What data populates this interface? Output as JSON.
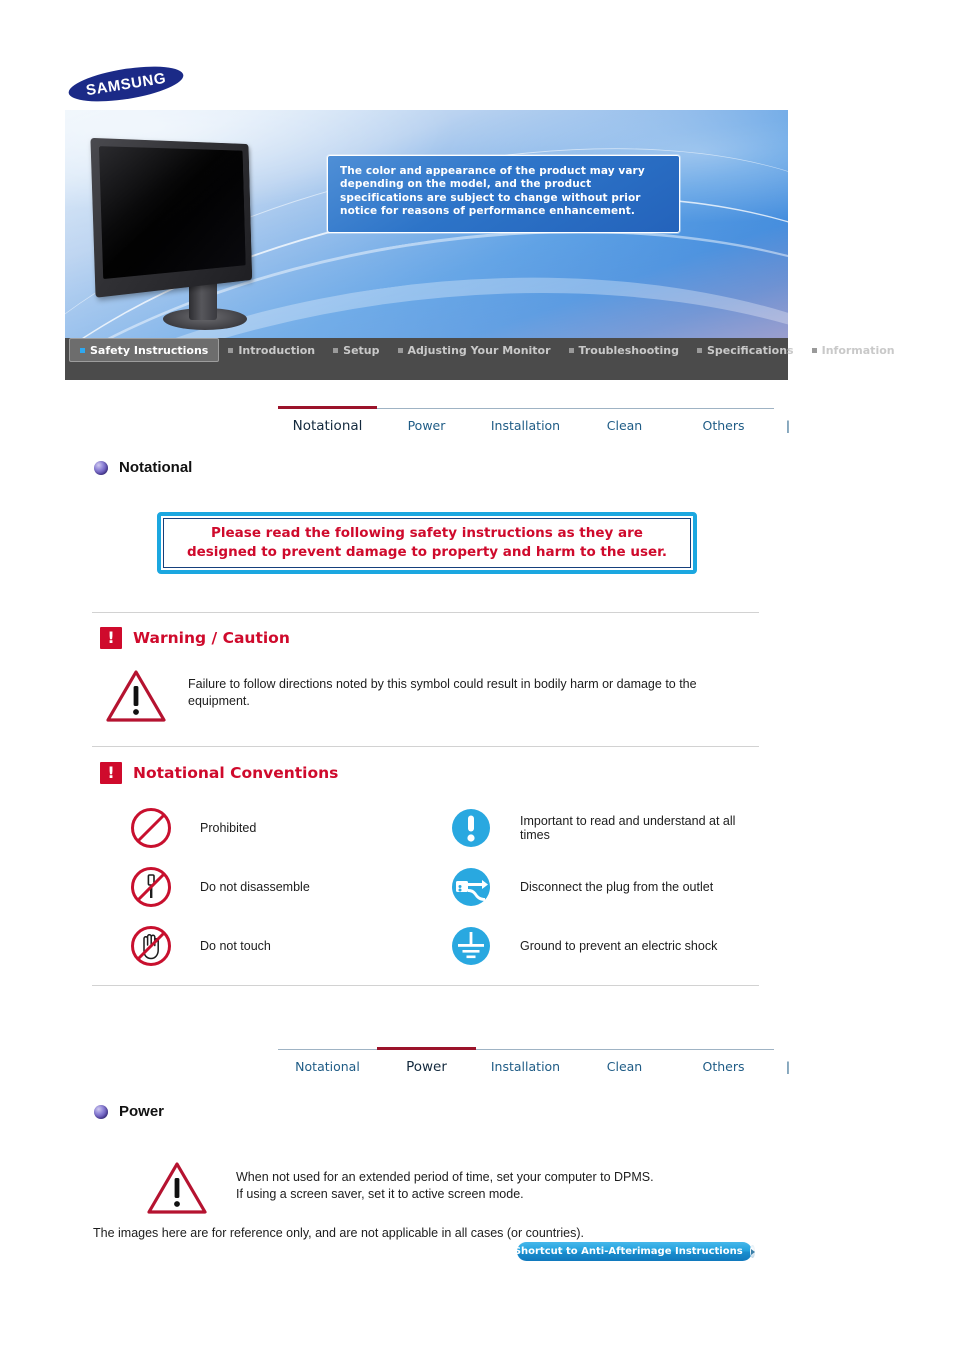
{
  "brand": {
    "logo_text": "SAMSUNG"
  },
  "banner": {
    "notice_text": "The color and appearance of the product may vary depending on the model, and the product specifications are subject to change without prior notice for reasons of performance enhancement.",
    "monitor_icon": "lcd-monitor-illustration"
  },
  "nav": {
    "items": [
      {
        "label": "Safety Instructions",
        "active": true
      },
      {
        "label": "Introduction",
        "active": false
      },
      {
        "label": "Setup",
        "active": false
      },
      {
        "label": "Adjusting Your Monitor",
        "active": false
      },
      {
        "label": "Troubleshooting",
        "active": false
      },
      {
        "label": "Specifications",
        "active": false
      },
      {
        "label": "Information",
        "active": false
      }
    ]
  },
  "tabs_notational": [
    {
      "label": "Notational",
      "active": true
    },
    {
      "label": "Power",
      "active": false
    },
    {
      "label": "Installation",
      "active": false
    },
    {
      "label": "Clean",
      "active": false
    },
    {
      "label": "Others",
      "active": false
    }
  ],
  "tabs_power": [
    {
      "label": "Notational",
      "active": false
    },
    {
      "label": "Power",
      "active": true
    },
    {
      "label": "Installation",
      "active": false
    },
    {
      "label": "Clean",
      "active": false
    },
    {
      "label": "Others",
      "active": false
    }
  ],
  "notational_section": {
    "heading": "Notational",
    "notice_line1": "Please read the following safety instructions as they are",
    "notice_line2": "designed to prevent damage to property and harm to the user.",
    "warning": {
      "heading": "Warning / Caution",
      "excl": "!",
      "body": "Failure to follow directions noted by this symbol could result in bodily harm or damage to the equipment."
    },
    "conventions": {
      "heading": "Notational Conventions",
      "excl": "!",
      "rows": [
        {
          "left_icon": "prohibited-icon",
          "left_label": "Prohibited",
          "right_icon": "important-exclamation-icon",
          "right_label": "Important to read and understand at all times"
        },
        {
          "left_icon": "do-not-disassemble-icon",
          "left_label": "Do not disassemble",
          "right_icon": "disconnect-plug-icon",
          "right_label": "Disconnect the plug from the outlet"
        },
        {
          "left_icon": "do-not-touch-icon",
          "left_label": "Do not touch",
          "right_icon": "ground-earth-icon",
          "right_label": "Ground to prevent an electric shock"
        }
      ]
    }
  },
  "power_section": {
    "heading": "Power",
    "warning_line1": "When not used for an extended period of time, set your computer to DPMS.",
    "warning_line2": "If using a screen saver, set it to active screen mode.",
    "reference_note": "The images here are for reference only, and are not applicable in all cases (or countries).",
    "shortcut_label": "Shortcut to Anti-Afterimage Instructions",
    "shortcut_icon": "play-arrow-icon"
  },
  "colors": {
    "samsung_blue": "#1b2a87",
    "accent_red": "#cf0a2c",
    "tab_active_underline": "#9b132a",
    "tab_link": "#1f5c86",
    "notice_border": "#1ba7e0",
    "icon_blue": "#29a8e0",
    "icon_red": "#c8102e",
    "nav_bg": "#4b4b4b",
    "button_blue": "#23a0dd"
  }
}
